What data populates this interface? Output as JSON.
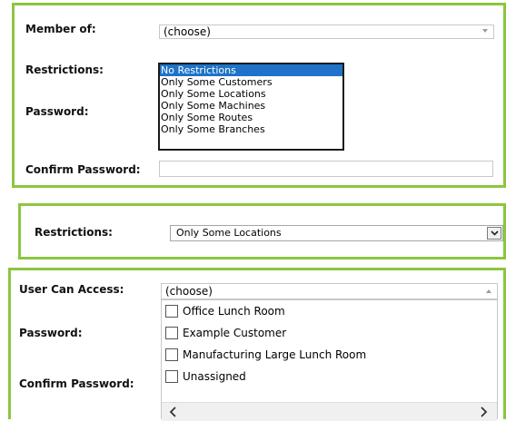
{
  "panel1": {
    "member_of_label": "Member of:",
    "member_of_value": "(choose)",
    "restrictions_label": "Restrictions:",
    "password_label": "Password:",
    "confirm_password_label": "Confirm Password:",
    "restriction_options": [
      "No Restrictions",
      "Only Some Customers",
      "Only Some Locations",
      "Only Some Machines",
      "Only Some Routes",
      "Only Some Branches"
    ],
    "selected_option": "No Restrictions"
  },
  "panel2": {
    "restrictions_label": "Restrictions:",
    "restrictions_value": "Only Some Locations"
  },
  "panel3": {
    "user_can_access_label": "User Can Access:",
    "user_can_access_value": "(choose)",
    "password_label": "Password:",
    "confirm_password_label": "Confirm Password:",
    "access_options": [
      "Office Lunch Room",
      "Example Customer",
      "Manufacturing Large Lunch Room",
      "Unassigned"
    ]
  },
  "colors": {
    "panel_border": "#8cc63f",
    "selection_highlight": "#1e73c8"
  }
}
